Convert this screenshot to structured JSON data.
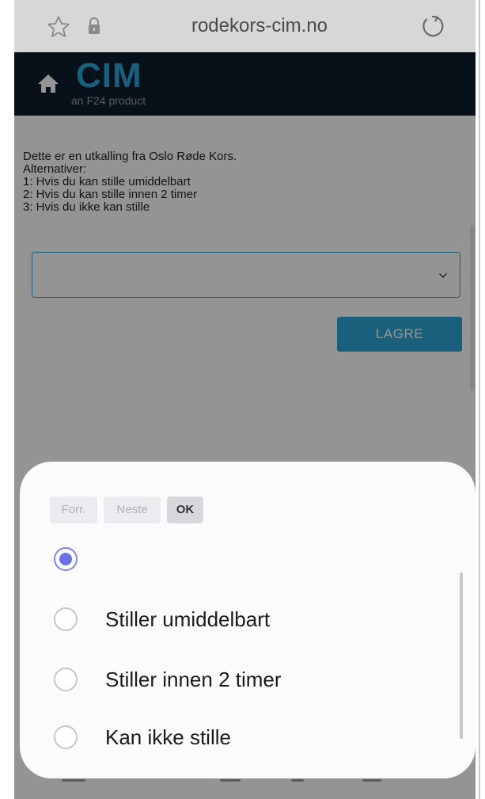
{
  "browser": {
    "url": "rodekors-cim.no"
  },
  "app": {
    "logo": "CIM",
    "tagline": "an F24 product"
  },
  "message": {
    "lines": [
      "Dette er en utkalling fra Oslo Røde Kors.",
      "Alternativer:",
      "1: Hvis du kan stille umiddelbart",
      "2: Hvis du kan stille innen 2 timer",
      "3: Hvis du ikke kan stille"
    ]
  },
  "form": {
    "select_value": "",
    "save_label": "LAGRE"
  },
  "picker": {
    "prev_label": "Forr.",
    "next_label": "Neste",
    "ok_label": "OK",
    "options": [
      {
        "label": "",
        "selected": true
      },
      {
        "label": "Stiller umiddelbart",
        "selected": false
      },
      {
        "label": "Stiller innen 2 timer",
        "selected": false
      },
      {
        "label": "Kan ikke stille",
        "selected": false
      }
    ]
  },
  "colors": {
    "accent": "#2aa6d6",
    "header_bg": "#0e1d2d",
    "radio_selected": "#6a72e8"
  },
  "icons": [
    "star-icon",
    "lock-icon",
    "reload-icon",
    "home-icon",
    "chevron-down-icon"
  ]
}
